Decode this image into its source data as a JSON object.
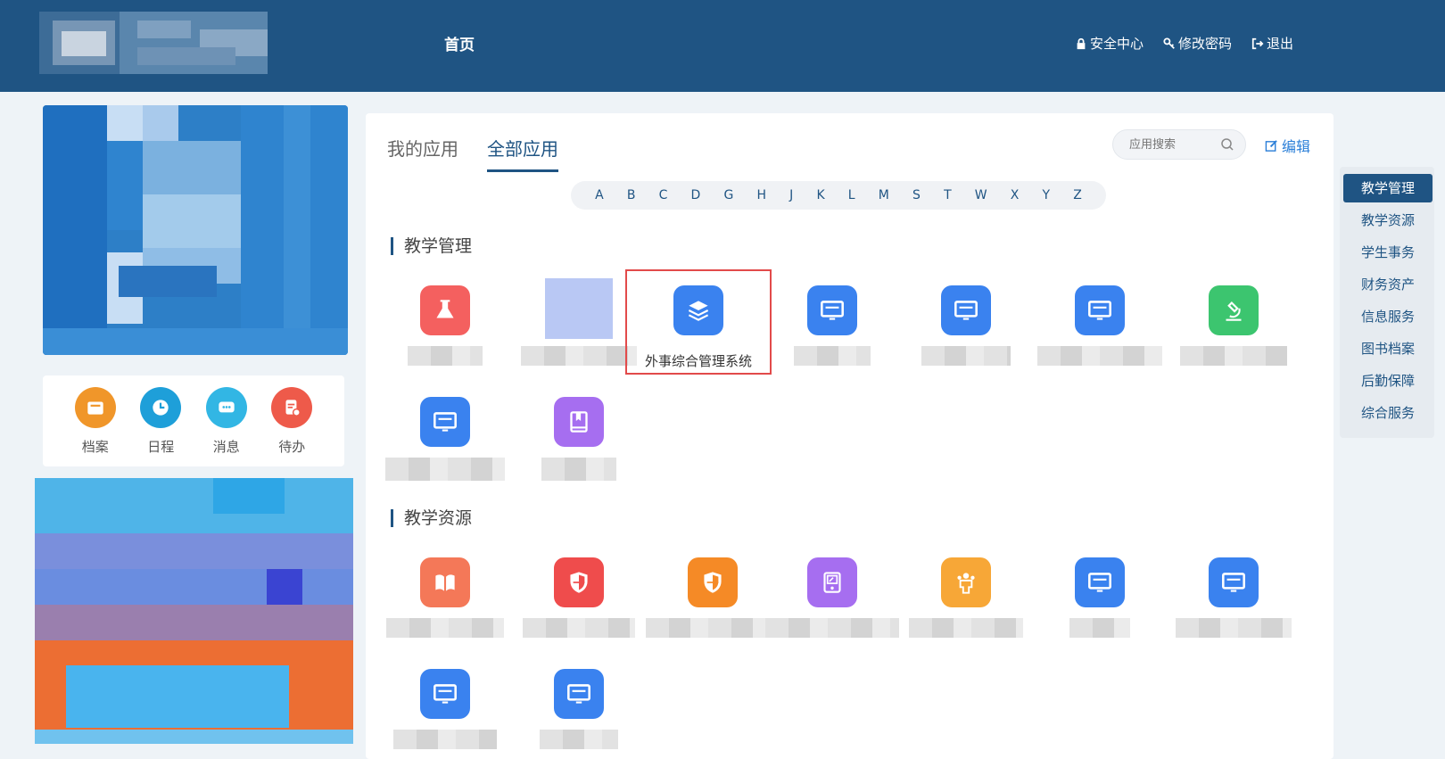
{
  "header": {
    "nav_home": "首页",
    "links": {
      "security": "安全中心",
      "password": "修改密码",
      "logout": "退出"
    }
  },
  "quick": [
    {
      "label": "档案",
      "color": "#f0962a"
    },
    {
      "label": "日程",
      "color": "#1e9fd9"
    },
    {
      "label": "消息",
      "color": "#32b6e4"
    },
    {
      "label": "待办",
      "color": "#ee5a4a"
    }
  ],
  "main": {
    "tabs": [
      "我的应用",
      "全部应用"
    ],
    "active_tab": "全部应用",
    "search_placeholder": "应用搜索",
    "edit_label": "编辑",
    "letters": [
      "A",
      "B",
      "C",
      "D",
      "G",
      "H",
      "J",
      "K",
      "L",
      "M",
      "S",
      "T",
      "W",
      "X",
      "Y",
      "Z"
    ],
    "sections": [
      {
        "title": "教学管理"
      },
      {
        "title": "教学资源"
      }
    ],
    "highlighted_app": "外事综合管理系统"
  },
  "categories": [
    "教学管理",
    "教学资源",
    "学生事务",
    "财务资产",
    "信息服务",
    "图书档案",
    "后勤保障",
    "综合服务"
  ],
  "active_category": "教学管理"
}
